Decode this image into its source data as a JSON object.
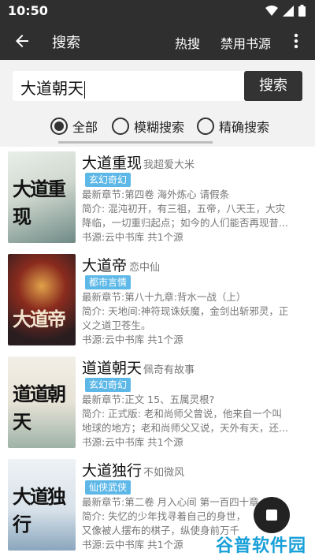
{
  "status": {
    "time": "10:50"
  },
  "toolbar": {
    "title": "搜索",
    "hot": "热搜",
    "disabled_sources": "禁用书源"
  },
  "search": {
    "value": "大道朝天",
    "button": "搜索"
  },
  "filters": [
    {
      "label": "全部",
      "selected": true
    },
    {
      "label": "模糊搜索",
      "selected": false
    },
    {
      "label": "精确搜索",
      "selected": false
    }
  ],
  "books": [
    {
      "name": "大道重现",
      "author": "我超爱大米",
      "tag": "玄幻奇幻",
      "latest": "最新章节:第四卷  海外炼心  请假条",
      "intro1": "简介: 混沌初开，有三祖，五帝，八天王，大灾",
      "intro2": "降临，一切重归起点；如今的人们能否再现昔...",
      "source": "书源:云中书库 共1个源",
      "cover_text": "大道重现",
      "cover_colors": [
        "#cfd8cf",
        "#6f8a86"
      ]
    },
    {
      "name": "大道帝",
      "author": "恋中仙",
      "tag": "都市言情",
      "latest": "最新章节:第八十九章:背水一战（上）",
      "intro1": "简介: 天地间:神符现诛妖魔，金剑出斩邪灵，正",
      "intro2": "义之道卫苍生。",
      "source": "书源:云中书库 共1个源",
      "cover_text": "大道帝",
      "cover_colors": [
        "#2a1d20",
        "#8a2b1e"
      ]
    },
    {
      "name": "道道朝天",
      "author": "佩奇有故事",
      "tag": "玄幻奇幻",
      "latest": "最新章节:正文 15、五属灵根?",
      "intro1": "简介: 正式版:  老和尚师父曾说，他来自一个叫",
      "intro2": "地球的地方；老和尚师父又说，天外有天，还...",
      "source": "书源:云中书库 共1个源",
      "cover_text": "道道朝天",
      "cover_colors": [
        "#e6e2d6",
        "#9fb3a8"
      ]
    },
    {
      "name": "大道独行",
      "author": "不如微风",
      "tag": "仙侠武侠",
      "latest": "最新章节:第二卷  月入心间  第一百四十章  以人",
      "intro1": "简介: 失忆的少年找寻着自己的身世，",
      "intro2": "又像被人摆布的棋子，纵使身前万千",
      "source": "书源:云中书库 共1个源",
      "cover_text": "大道独行",
      "cover_colors": [
        "#d8e2ea",
        "#8aa6bd"
      ]
    }
  ],
  "watermark": {
    "text": "谷普软件园"
  },
  "colors": {
    "toolbar": "#2f2f2f",
    "tag": "#5db8e8",
    "panel": "#f2f2f2"
  }
}
